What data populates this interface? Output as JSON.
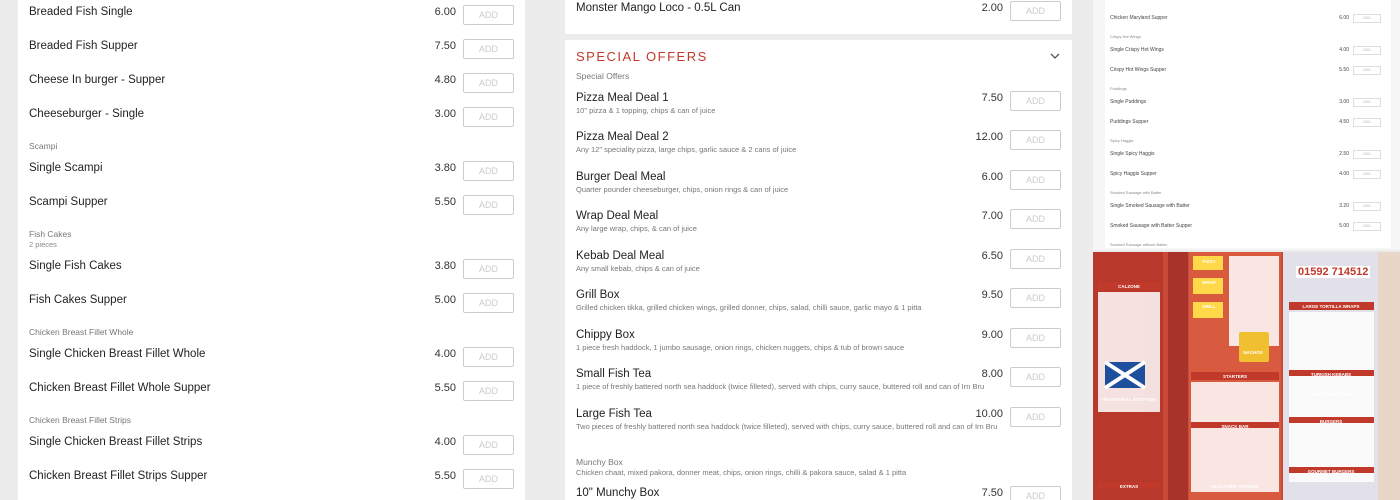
{
  "left": {
    "items": [
      {
        "name": "Breaded Fish Single",
        "price": "6.00"
      },
      {
        "name": "Breaded Fish Supper",
        "price": "7.50"
      },
      {
        "name": "Cheese In burger - Supper",
        "price": "4.80"
      },
      {
        "name": "Cheeseburger - Single",
        "price": "3.00"
      },
      {
        "name": "Single Scampi",
        "price": "3.80"
      },
      {
        "name": "Scampi Supper",
        "price": "5.50"
      },
      {
        "name": "Single Fish Cakes",
        "price": "3.80"
      },
      {
        "name": "Fish Cakes Supper",
        "price": "5.00"
      },
      {
        "name": "Single Chicken Breast Fillet Whole",
        "price": "4.00"
      },
      {
        "name": "Chicken Breast Fillet Whole Supper",
        "price": "5.50"
      },
      {
        "name": "Single Chicken Breast Fillet Strips",
        "price": "4.00"
      },
      {
        "name": "Chicken Breast Fillet Strips Supper",
        "price": "5.50"
      }
    ],
    "categories": {
      "scampi": "Scampi",
      "fish_cakes": "Fish Cakes",
      "fish_cakes_sub": "2 pieces",
      "cbf_whole": "Chicken Breast Fillet Whole",
      "cbf_strips": "Chicken Breast Fillet Strips"
    }
  },
  "add_label": "ADD",
  "mid_top": {
    "name": "Monster Mango Loco - 0.5L Can",
    "price": "2.00"
  },
  "special": {
    "title": "SPECIAL OFFERS",
    "subheading": "Special Offers",
    "items": [
      {
        "name": "Pizza Meal Deal 1",
        "desc": "10\" pizza & 1 topping, chips & can of juice",
        "price": "7.50"
      },
      {
        "name": "Pizza Meal Deal 2",
        "desc": "Any 12\" speciality pizza, large chips, garlic sauce & 2 cans of juice",
        "price": "12.00"
      },
      {
        "name": "Burger Deal Meal",
        "desc": "Quarter pounder cheeseburger, chips, onion rings & can of juice",
        "price": "6.00"
      },
      {
        "name": "Wrap Deal Meal",
        "desc": "Any large wrap, chips, & can of juice",
        "price": "7.00"
      },
      {
        "name": "Kebab Deal Meal",
        "desc": "Any small kebab, chips & can of juice",
        "price": "6.50"
      },
      {
        "name": "Grill Box",
        "desc": "Grilled chicken tikka, grilled chicken wings, grilled donner, chips, salad, chilli sauce, garlic mayo & 1 pitta",
        "price": "9.50"
      },
      {
        "name": "Chippy Box",
        "desc": "1 piece fresh haddock, 1 jumbo sausage, onion rings, chicken nuggets, chips & tub of brown sauce",
        "price": "9.00"
      },
      {
        "name": "Small Fish Tea",
        "desc": "1 piece of freshly battered north sea haddock (twice filleted), served with chips, curry sauce, buttered roll and can of Irn Bru",
        "price": "8.00"
      },
      {
        "name": "Large Fish Tea",
        "desc": "Two pieces of freshly battered north sea haddock (twice filleted), served with chips, curry sauce, buttered roll and can of Irn Bru",
        "price": "10.00"
      }
    ],
    "munchy_cat": "Munchy Box",
    "munchy_desc": "Chicken chaat, mixed pakora, donner meat, chips, onion rings, chilli & pakora sauce, salad & 1 pitta",
    "munchy_item": {
      "name": "10\" Munchy Box",
      "price": "7.50"
    }
  },
  "mini": {
    "rows": [
      {
        "type": "item",
        "name": "Chicken Maryland Supper",
        "price": "6.00"
      },
      {
        "type": "head",
        "name": "Crispy Hot Wings"
      },
      {
        "type": "item",
        "name": "Single Crispy Hot Wings",
        "price": "4.00"
      },
      {
        "type": "item",
        "name": "Crispy Hot Wings Supper",
        "price": "5.50"
      },
      {
        "type": "head",
        "name": "Puddings"
      },
      {
        "type": "item",
        "name": "Single Puddings",
        "price": "3.00"
      },
      {
        "type": "item",
        "name": "Puddings Supper",
        "price": "4.50"
      },
      {
        "type": "head",
        "name": "Spicy Haggis"
      },
      {
        "type": "item",
        "name": "Single Spicy Haggis",
        "price": "2.50"
      },
      {
        "type": "item",
        "name": "Spicy Haggis Supper",
        "price": "4.00"
      },
      {
        "type": "head",
        "name": "Smoked Sausage with Batter"
      },
      {
        "type": "item",
        "name": "Single Smoked Sausage with Batter",
        "price": "3.20"
      },
      {
        "type": "item",
        "name": "Smoked Sausage with Batter Supper",
        "price": "5.00"
      },
      {
        "type": "head",
        "name": "Smoked Sausage without Batter"
      }
    ]
  },
  "photo": {
    "phone": "01592 714512",
    "labels": [
      "TRADITIONAL SCOTTISH FISH & CHIPS",
      "STARTERS",
      "SNACK BAR",
      "TURKISH KEBABS",
      "BURGERS",
      "GOURMET BURGERS",
      "EXTRAS",
      "HEALTHIER OPTIONS",
      "NACHOS",
      "CALZONE",
      "LARGE TORTILLA WRAPS",
      "BAKED POTATOES",
      "PIZZA",
      "WRAP",
      "GRILL"
    ]
  },
  "colors": {
    "accent": "#c0392b"
  }
}
